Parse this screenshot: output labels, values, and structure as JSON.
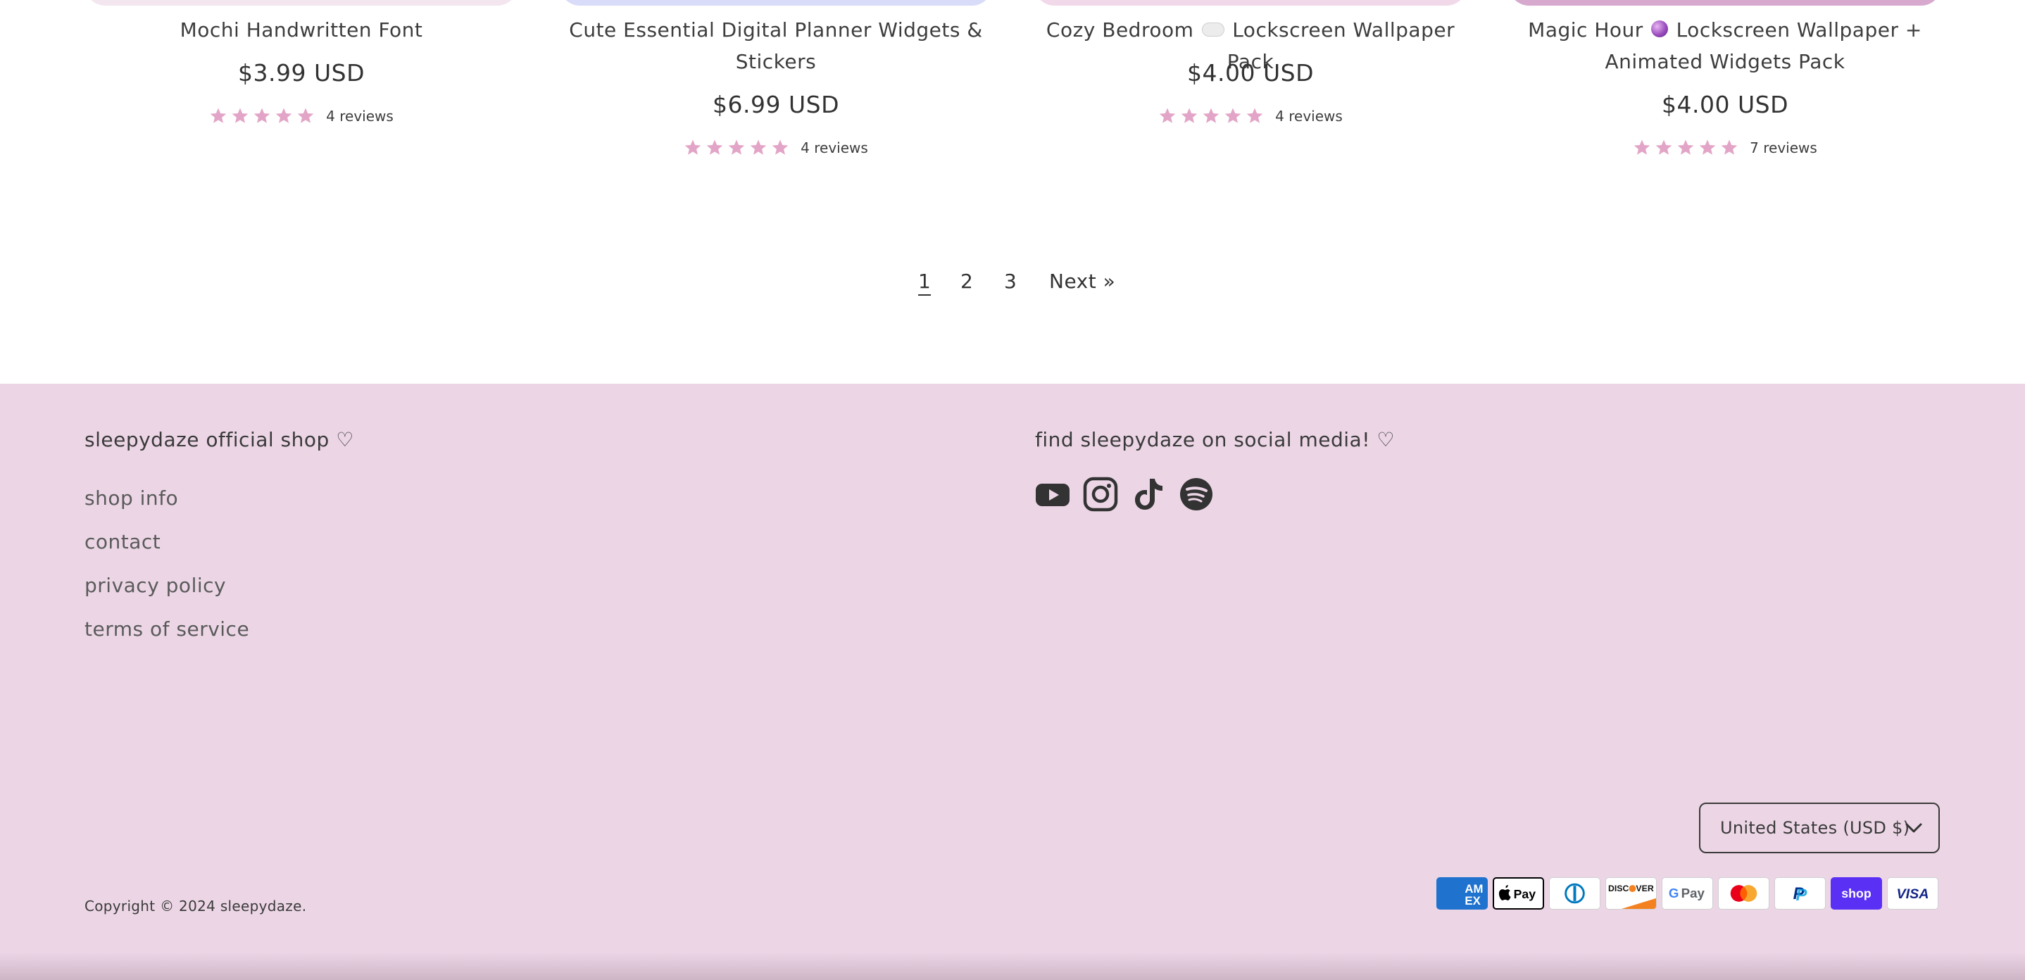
{
  "products": [
    {
      "title": "Mochi Handwritten Font",
      "price": "$3.99 USD",
      "reviews": "4 reviews",
      "rating": 5,
      "thumb_color": "#f3e6ee"
    },
    {
      "title": "Cute Essential Digital Planner Widgets & Stickers",
      "price": "$6.99 USD",
      "reviews": "4 reviews",
      "rating": 5,
      "thumb_color": "#d9dcf8"
    },
    {
      "title_pre": "Cozy Bedroom",
      "title_icon": "cloud-icon",
      "title_post": "Lockscreen Wallpaper Pack",
      "price": "$4.00 USD",
      "reviews": "4 reviews",
      "rating": 5,
      "thumb_color": "#f1d9ea"
    },
    {
      "title_pre": "Magic Hour",
      "title_icon": "crystal-ball-icon",
      "title_post": "Lockscreen Wallpaper + Animated Widgets Pack",
      "price": "$4.00 USD",
      "reviews": "7 reviews",
      "rating": 5,
      "thumb_color": "#d7a9cf"
    }
  ],
  "star_color": "#e3a5c7",
  "pagination": {
    "pages": [
      "1",
      "2",
      "3"
    ],
    "current": "1",
    "next_label": "Next »"
  },
  "footer": {
    "background": "#ecd6e6",
    "shop_heading": "sleepydaze official shop ♡",
    "menu": [
      "shop info",
      "contact",
      "privacy policy",
      "terms of service"
    ],
    "social_heading": "find sleepydaze on social media! ♡",
    "social_icons": [
      "youtube-icon",
      "instagram-icon",
      "tiktok-icon",
      "spotify-icon"
    ],
    "country_selector": "United States (USD $)",
    "payment_methods": [
      "American Express",
      "Apple Pay",
      "Diners Club",
      "Discover",
      "Google Pay",
      "Mastercard",
      "PayPal",
      "Shop Pay",
      "Visa"
    ],
    "copyright_prefix": "Copyright © 2024",
    "copyright_link": "sleepydaze",
    "copyright_suffix": "."
  }
}
